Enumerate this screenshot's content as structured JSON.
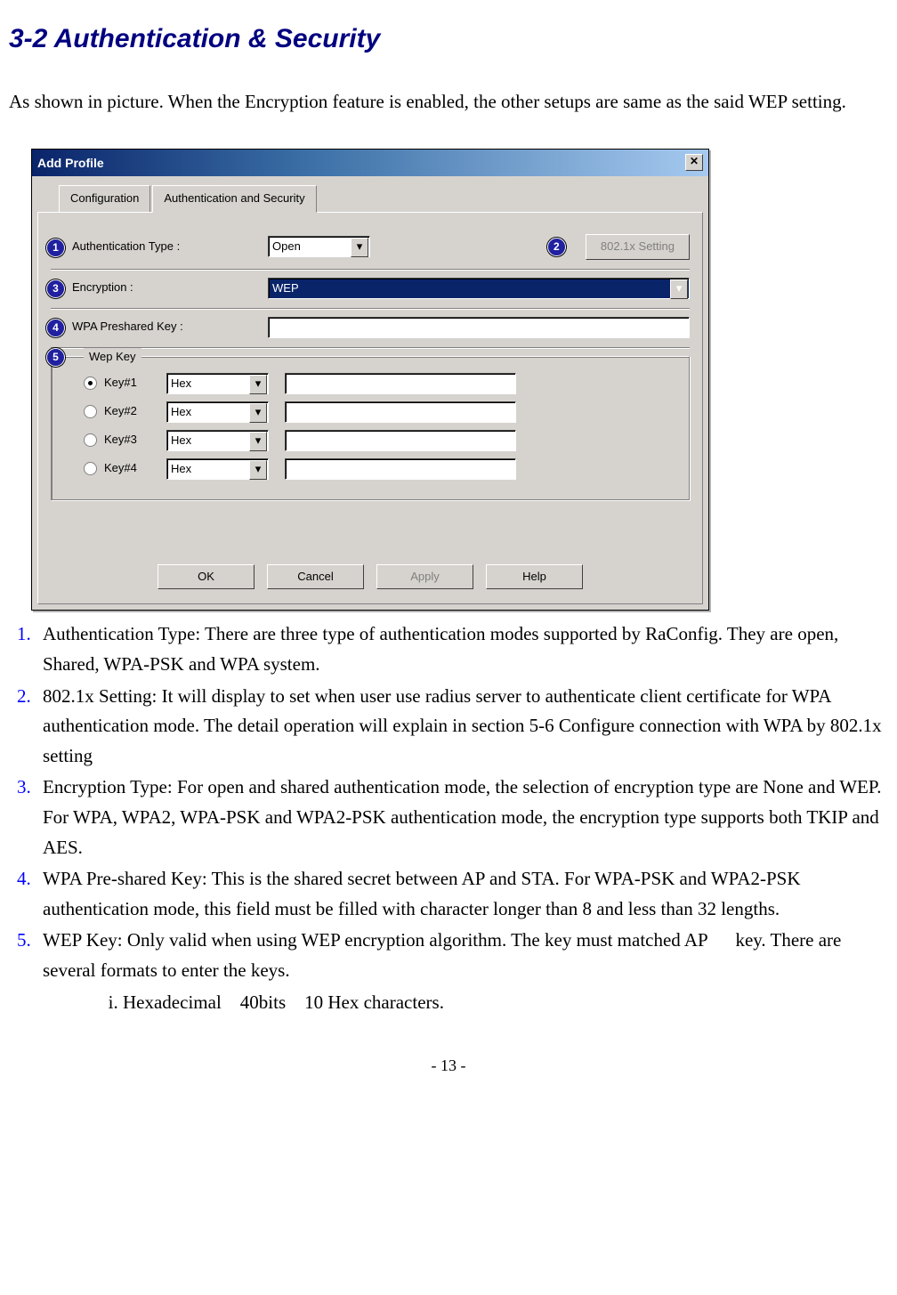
{
  "heading": "3-2 Authentication & Security",
  "intro": "As shown in picture. When the Encryption feature is enabled, the other setups are same as the said WEP setting.",
  "dialog": {
    "title": "Add Profile",
    "close": "✕",
    "tabs": {
      "config": "Configuration",
      "auth": "Authentication and Security"
    },
    "badges": {
      "b1": "1",
      "b2": "2",
      "b3": "3",
      "b4": "4",
      "b5": "5"
    },
    "labels": {
      "authtype": "Authentication Type :",
      "encryption": "Encryption :",
      "wpakey": "WPA Preshared Key :",
      "wepkey": "Wep Key",
      "k1": "Key#1",
      "k2": "Key#2",
      "k3": "Key#3",
      "k4": "Key#4"
    },
    "values": {
      "authtype": "Open",
      "encryption": "WEP",
      "hex": "Hex"
    },
    "buttons": {
      "dot1x": "802.1x Setting",
      "ok": "OK",
      "cancel": "Cancel",
      "apply": "Apply",
      "help": "Help"
    }
  },
  "list": {
    "i1": "Authentication Type: There are three type of authentication modes supported by RaConfig. They are open, Shared, WPA-PSK and WPA system.",
    "i2": "802.1x Setting: It will display to set when user use radius server to authenticate client certificate for WPA authentication mode. The detail operation will explain in section 5-6 Configure connection with WPA by 802.1x setting",
    "i3": "Encryption Type: For open and shared authentication mode, the selection of encryption type are None and WEP. For WPA, WPA2, WPA-PSK and WPA2-PSK authentication mode, the encryption type supports both TKIP and AES.",
    "i4": "WPA Pre-shared Key: This is the shared secret between AP and STA. For WPA-PSK and WPA2-PSK authentication mode, this field must be filled with character longer than 8 and less than 32 lengths.",
    "i5": "WEP Key: Only valid when using WEP encryption algorithm. The key must matched AP 　 key. There are several formats to enter the keys.",
    "i5a": "Hexadecimal　40bits　10 Hex characters."
  },
  "pagenum": "- 13 -"
}
